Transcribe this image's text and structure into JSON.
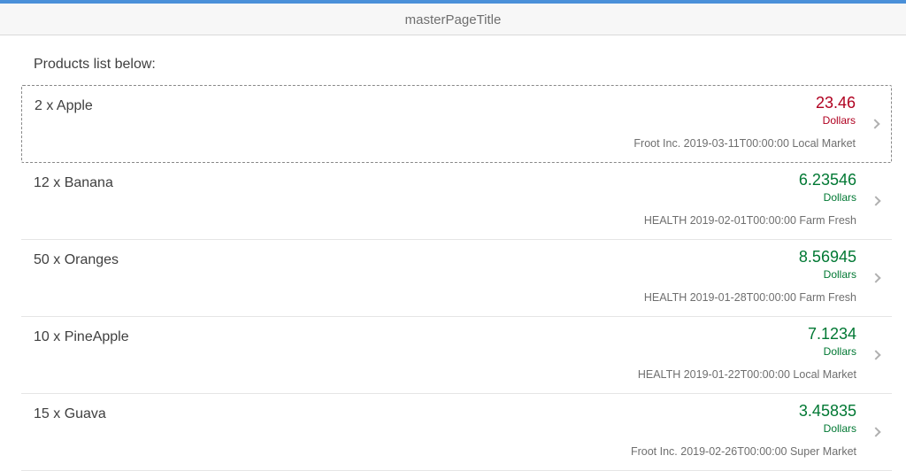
{
  "header": {
    "title": "masterPageTitle"
  },
  "listHeading": "Products list below:",
  "currencyLabel": "Dollars",
  "items": [
    {
      "title": "2 x Apple",
      "price": "23.46",
      "priceStyle": "red",
      "supplier": "Froot Inc.",
      "date": "2019-03-11T00:00:00",
      "market": "Local Market",
      "selected": true
    },
    {
      "title": "12 x Banana",
      "price": "6.23546",
      "priceStyle": "green",
      "supplier": "HEALTH",
      "date": "2019-02-01T00:00:00",
      "market": "Farm Fresh",
      "selected": false
    },
    {
      "title": "50 x Oranges",
      "price": "8.56945",
      "priceStyle": "green",
      "supplier": "HEALTH",
      "date": "2019-01-28T00:00:00",
      "market": "Farm Fresh",
      "selected": false
    },
    {
      "title": "10 x PineApple",
      "price": "7.1234",
      "priceStyle": "green",
      "supplier": "HEALTH",
      "date": "2019-01-22T00:00:00",
      "market": "Local Market",
      "selected": false
    },
    {
      "title": "15 x Guava",
      "price": "3.45835",
      "priceStyle": "green",
      "supplier": "Froot Inc.",
      "date": "2019-02-26T00:00:00",
      "market": "Super Market",
      "selected": false
    }
  ]
}
